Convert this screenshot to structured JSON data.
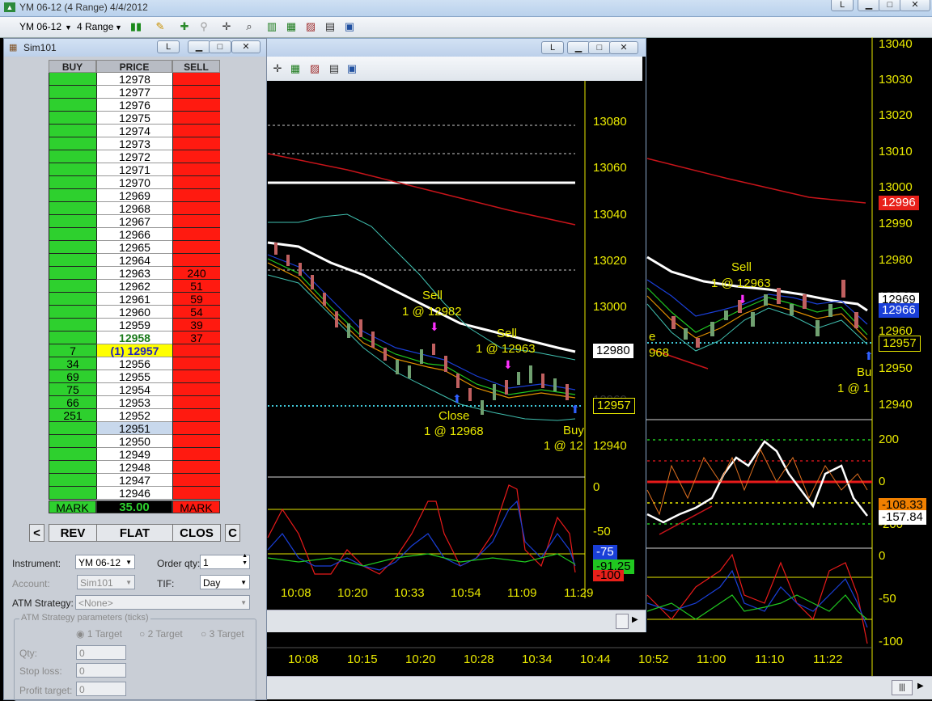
{
  "window": {
    "title": "YM 06-12 (4 Range)  4/4/2012",
    "btn_l": "L"
  },
  "toolbar": {
    "instrument": "YM 06-12",
    "interval": "4 Range"
  },
  "back_chart": {
    "price_axis": [
      "13040",
      "13030",
      "13020",
      "13010",
      "13000",
      "12990",
      "12980",
      "12970",
      "12960",
      "12950",
      "12940"
    ],
    "tags": [
      {
        "text": "12996",
        "color": "#e8201a",
        "fg": "#ffffff"
      },
      {
        "text": "12969",
        "color": "#ffffff",
        "fg": "#000000"
      },
      {
        "text": "12966",
        "color": "#1a3fd8",
        "fg": "#ffffff"
      },
      {
        "text": "12957",
        "color": "#000000",
        "fg": "#e8e800"
      }
    ],
    "annotations": [
      {
        "text": "Sell"
      },
      {
        "text": "1 @ 12963"
      },
      {
        "text": "e"
      },
      {
        "text": "968"
      },
      {
        "text": "Bu"
      },
      {
        "text": "1 @ 1"
      }
    ],
    "ind1_axis": [
      "200",
      "0",
      "-200"
    ],
    "ind1_tags": [
      {
        "text": "-108.33",
        "color": "#f08000",
        "fg": "#000"
      },
      {
        "text": "-157.84",
        "color": "#ffffff",
        "fg": "#000"
      }
    ],
    "ind2_axis": [
      "0",
      "-50",
      "-100"
    ],
    "time_axis": [
      "10:08",
      "10:15",
      "10:20",
      "10:28",
      "10:34",
      "10:44",
      "10:52",
      "11:00",
      "11:10",
      "11:22"
    ],
    "scroll_btn": "|||"
  },
  "inner_chart": {
    "btn_l": "L",
    "price_axis": [
      "13080",
      "13060",
      "13040",
      "13020",
      "13000",
      "12960",
      "12940"
    ],
    "tags": [
      {
        "text": "12980",
        "color": "#ffffff",
        "fg": "#000"
      },
      {
        "text": "12957",
        "color": "#000",
        "fg": "#e8e800"
      }
    ],
    "annotations": [
      {
        "text": "Sell"
      },
      {
        "text": "1 @ 12982"
      },
      {
        "text": "Sell"
      },
      {
        "text": "1 @ 12963"
      },
      {
        "text": "Close"
      },
      {
        "text": "1 @ 12968"
      },
      {
        "text": "Buy"
      },
      {
        "text": "1 @ 12"
      }
    ],
    "ind1_axis": [
      "0",
      "-50"
    ],
    "ind1_tags": [
      {
        "text": "-75",
        "color": "#1a3fd8",
        "fg": "#fff"
      },
      {
        "text": "-91.25",
        "color": "#20c820",
        "fg": "#000"
      },
      {
        "text": "-100",
        "color": "#e8201a",
        "fg": "#000"
      }
    ],
    "time_axis": [
      "10:08",
      "10:20",
      "10:33",
      "10:54",
      "11:09",
      "11:29"
    ]
  },
  "dom": {
    "title": "Sim101",
    "btn_l": "L",
    "headers": {
      "buy": "BUY",
      "price": "PRICE",
      "sell": "SELL"
    },
    "rows": [
      {
        "buy": "",
        "price": "12978",
        "sell": ""
      },
      {
        "buy": "",
        "price": "12977",
        "sell": ""
      },
      {
        "buy": "",
        "price": "12976",
        "sell": ""
      },
      {
        "buy": "",
        "price": "12975",
        "sell": ""
      },
      {
        "buy": "",
        "price": "12974",
        "sell": ""
      },
      {
        "buy": "",
        "price": "12973",
        "sell": ""
      },
      {
        "buy": "",
        "price": "12972",
        "sell": ""
      },
      {
        "buy": "",
        "price": "12971",
        "sell": ""
      },
      {
        "buy": "",
        "price": "12970",
        "sell": ""
      },
      {
        "buy": "",
        "price": "12969",
        "sell": ""
      },
      {
        "buy": "",
        "price": "12968",
        "sell": ""
      },
      {
        "buy": "",
        "price": "12967",
        "sell": ""
      },
      {
        "buy": "",
        "price": "12966",
        "sell": ""
      },
      {
        "buy": "",
        "price": "12965",
        "sell": ""
      },
      {
        "buy": "",
        "price": "12964",
        "sell": ""
      },
      {
        "buy": "",
        "price": "12963",
        "sell": "240"
      },
      {
        "buy": "",
        "price": "12962",
        "sell": "51"
      },
      {
        "buy": "",
        "price": "12961",
        "sell": "59"
      },
      {
        "buy": "",
        "price": "12960",
        "sell": "54"
      },
      {
        "buy": "",
        "price": "12959",
        "sell": "39"
      },
      {
        "buy": "",
        "price": "12958",
        "sell": "37",
        "style": "last"
      },
      {
        "buy": "7",
        "price": "(1) 12957",
        "sell": "",
        "style": "position"
      },
      {
        "buy": "34",
        "price": "12956",
        "sell": ""
      },
      {
        "buy": "69",
        "price": "12955",
        "sell": ""
      },
      {
        "buy": "75",
        "price": "12954",
        "sell": ""
      },
      {
        "buy": "66",
        "price": "12953",
        "sell": ""
      },
      {
        "buy": "251",
        "price": "12952",
        "sell": ""
      },
      {
        "buy": "",
        "price": "12951",
        "sell": "",
        "style": "selected"
      },
      {
        "buy": "",
        "price": "12950",
        "sell": ""
      },
      {
        "buy": "",
        "price": "12949",
        "sell": ""
      },
      {
        "buy": "",
        "price": "12948",
        "sell": ""
      },
      {
        "buy": "",
        "price": "12947",
        "sell": ""
      },
      {
        "buy": "",
        "price": "12946",
        "sell": ""
      }
    ],
    "footer": {
      "buy": "MARK",
      "pnl": "35.00",
      "sell": "MARK"
    },
    "buttons": {
      "left": "<",
      "rev": "REV",
      "flat": "FLAT",
      "close": "CLOS",
      "right": "C"
    },
    "form": {
      "instrument_label": "Instrument:",
      "instrument_value": "YM 06-12",
      "order_qty_label": "Order qty:",
      "order_qty_value": "1",
      "account_label": "Account:",
      "account_value": "Sim101",
      "tif_label": "TIF:",
      "tif_value": "Day",
      "atm_label": "ATM Strategy:",
      "atm_value": "<None>",
      "atm_params_label": "ATM Strategy parameters (ticks)",
      "target1": "1 Target",
      "target2": "2 Target",
      "target3": "3 Target",
      "qty_label": "Qty:",
      "qty_value": "0",
      "stop_label": "Stop loss:",
      "stop_value": "0",
      "profit_label": "Profit target:",
      "profit_value": "0"
    }
  }
}
